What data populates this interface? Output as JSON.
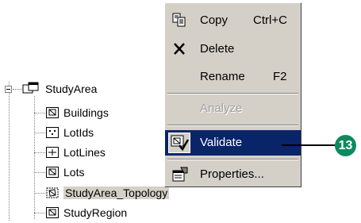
{
  "tree": {
    "root_label": "StudyArea",
    "children": [
      {
        "label": "Buildings",
        "icon": "polygon-feature-class-icon"
      },
      {
        "label": "LotIds",
        "icon": "point-feature-class-icon"
      },
      {
        "label": "LotLines",
        "icon": "line-feature-class-icon"
      },
      {
        "label": "Lots",
        "icon": "polygon-feature-class-icon"
      },
      {
        "label": "StudyArea_Topology",
        "icon": "topology-icon"
      },
      {
        "label": "StudyRegion",
        "icon": "polygon-feature-class-icon"
      }
    ]
  },
  "context_menu": {
    "items": [
      {
        "label": "Copy",
        "shortcut": "Ctrl+C",
        "icon": "copy-icon",
        "enabled": true
      },
      {
        "label": "Delete",
        "shortcut": "",
        "icon": "delete-icon",
        "enabled": true
      },
      {
        "label": "Rename",
        "shortcut": "F2",
        "icon": "",
        "enabled": true
      },
      {
        "label": "Analyze",
        "shortcut": "",
        "icon": "",
        "enabled": false
      },
      {
        "label": "Validate",
        "shortcut": "",
        "icon": "validate-icon",
        "enabled": true,
        "highlighted": true
      },
      {
        "label": "Properties...",
        "shortcut": "",
        "icon": "properties-icon",
        "enabled": true
      }
    ]
  },
  "callout": {
    "number": "13",
    "color": "#0d8a5e"
  },
  "colors": {
    "highlight": "#0a246a",
    "menu_bg": "#d4d0c8"
  }
}
